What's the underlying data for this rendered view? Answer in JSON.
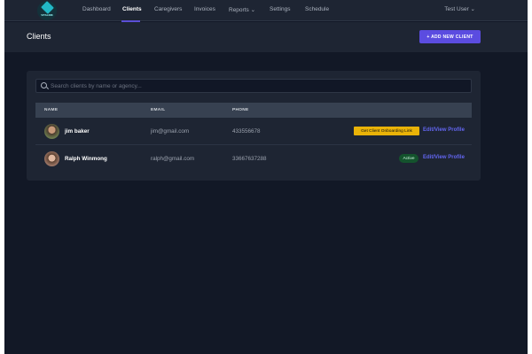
{
  "nav": {
    "logo_text": "VITALINK",
    "items": [
      {
        "label": "Dashboard"
      },
      {
        "label": "Clients"
      },
      {
        "label": "Caregivers"
      },
      {
        "label": "Invoices"
      },
      {
        "label": "Reports ⌄"
      },
      {
        "label": "Settings"
      },
      {
        "label": "Schedule"
      }
    ],
    "user": "Test User ⌄"
  },
  "page": {
    "title": "Clients",
    "add_button": "+ ADD NEW CLIENT"
  },
  "search": {
    "placeholder": "Search clients by name or agency...",
    "value": ""
  },
  "table": {
    "headers": [
      "NAME",
      "EMAIL",
      "PHONE"
    ],
    "rows": [
      {
        "name": "jim baker",
        "email": "jim@gmail.com",
        "phone": "433556678",
        "action": "Get Client Onboarding Link",
        "link": "Edit/View Profile"
      },
      {
        "name": "Ralph Winmong",
        "email": "ralph@gmail.com",
        "phone": "33667637288",
        "status": "Active",
        "link": "Edit/View Profile"
      }
    ]
  },
  "colors": {
    "accent": "#5b4ce0",
    "warning": "#eab308",
    "success": "#14532d"
  }
}
